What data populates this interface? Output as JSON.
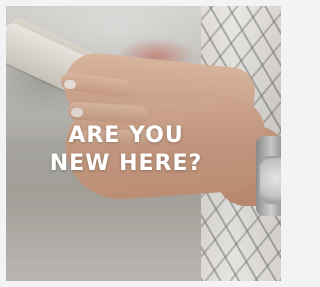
{
  "banner": {
    "headline_line1": "ARE YOU",
    "headline_line2": "NEW HERE?"
  },
  "colors": {
    "headline_text": "#ffffff",
    "page_background": "#f3f3f3"
  },
  "photo": {
    "subject": "hands-holding-phone-photo"
  }
}
